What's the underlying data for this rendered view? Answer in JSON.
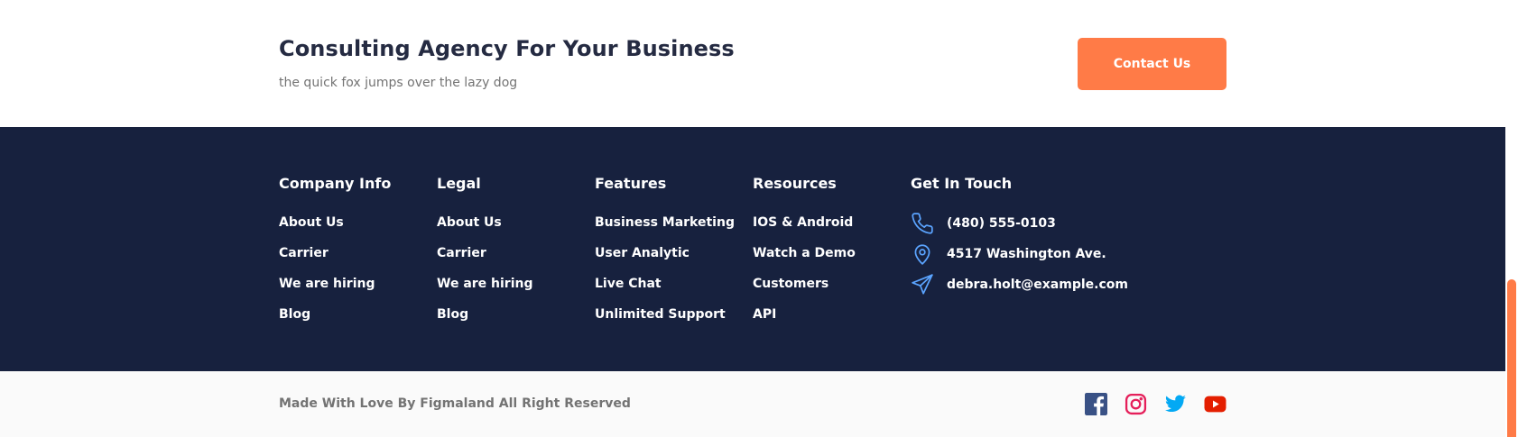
{
  "cta": {
    "title": "Consulting Agency For Your Business",
    "subtitle": "the quick fox jumps over the lazy dog",
    "button_label": "Contact Us"
  },
  "footer": {
    "columns": [
      {
        "title": "Company Info",
        "links": [
          "About Us",
          "Carrier",
          "We are hiring",
          "Blog"
        ]
      },
      {
        "title": "Legal",
        "links": [
          "About Us",
          "Carrier",
          "We are hiring",
          "Blog"
        ]
      },
      {
        "title": "Features",
        "links": [
          "Business Marketing",
          "User Analytic",
          "Live Chat",
          "Unlimited Support"
        ]
      },
      {
        "title": "Resources",
        "links": [
          "IOS & Android",
          "Watch a Demo",
          "Customers",
          "API"
        ]
      }
    ],
    "contact": {
      "title": "Get In Touch",
      "phone": "(480) 555-0103",
      "address": "4517 Washington Ave.",
      "email": "debra.holt@example.com"
    }
  },
  "bottom": {
    "copyright": "Made With Love By Figmaland All Right Reserved",
    "socials": [
      "facebook-icon",
      "instagram-icon",
      "twitter-icon",
      "youtube-icon"
    ]
  },
  "colors": {
    "accent": "#ff7b47",
    "footer_bg": "#17213e",
    "icon_blue": "#5ba4ff",
    "title": "#252b42",
    "muted": "#737373"
  }
}
